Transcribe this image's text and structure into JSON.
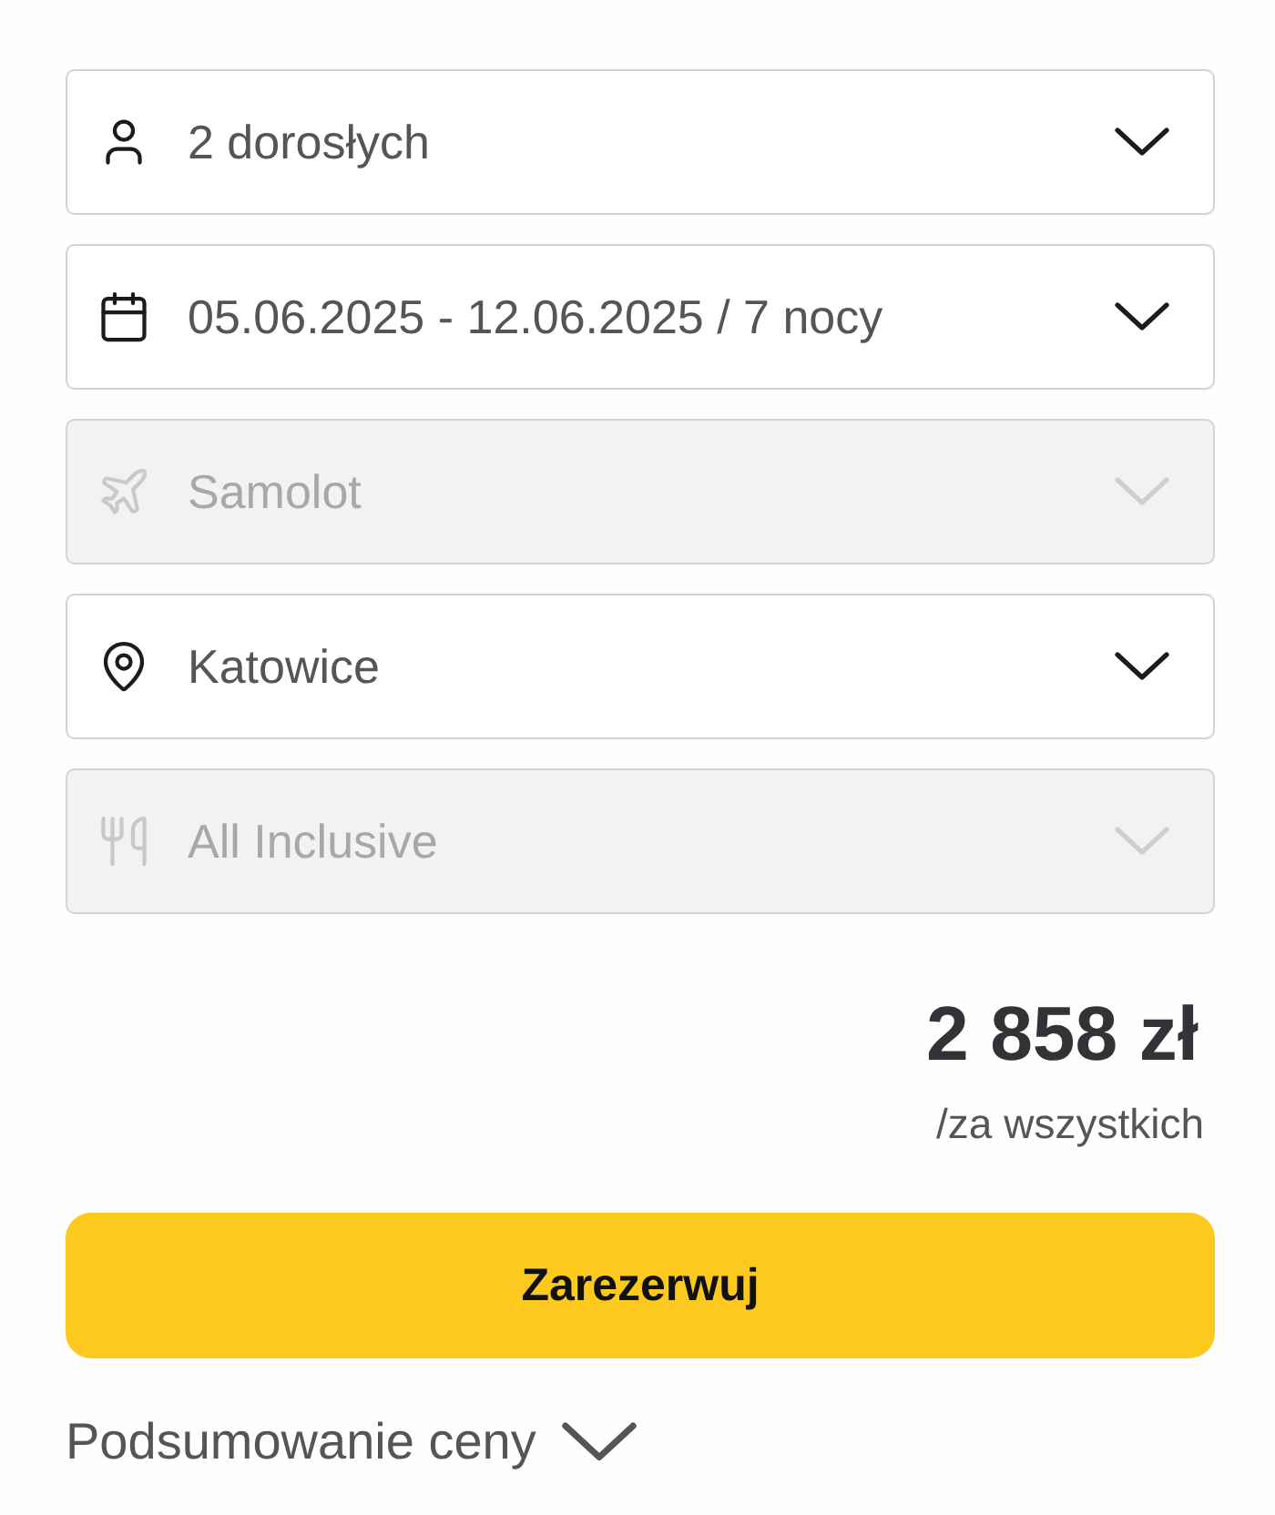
{
  "fields": [
    {
      "kind": "travelers",
      "value": "2 dorosłych",
      "disabled": false
    },
    {
      "kind": "dates",
      "value": "05.06.2025 - 12.06.2025 / 7 nocy",
      "disabled": false
    },
    {
      "kind": "transport",
      "value": "Samolot",
      "disabled": true
    },
    {
      "kind": "departure",
      "value": "Katowice",
      "disabled": false
    },
    {
      "kind": "board",
      "value": "All Inclusive",
      "disabled": true
    }
  ],
  "price": {
    "amount": "2 858 zł",
    "note": "/za wszystkich"
  },
  "reserve_button": {
    "label": "Zarezerwuj"
  },
  "price_summary": {
    "label": "Podsumowanie ceny",
    "expanded": false
  }
}
